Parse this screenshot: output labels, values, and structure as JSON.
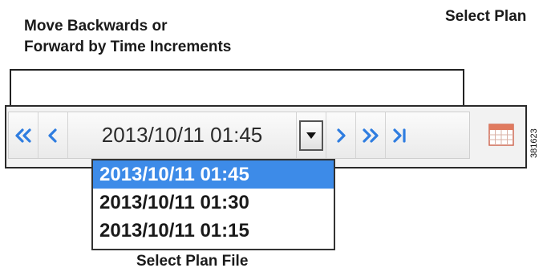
{
  "callouts": {
    "move_line1": "Move Backwards or",
    "move_line2": "Forward by Time Increments",
    "select_plan": "Select Plan",
    "select_plan_file": "Select Plan File"
  },
  "toolbar": {
    "current_time": "2013/10/11 01:45",
    "buttons": [
      "<<",
      "<",
      ">",
      ">>",
      ">|"
    ]
  },
  "dropdown": {
    "options": [
      "2013/10/11 01:45",
      "2013/10/11 01:30",
      "2013/10/11 01:15"
    ],
    "selected_index": 0
  },
  "figure_id": "381623",
  "icons": [
    "double-chevron-left-icon",
    "chevron-left-icon",
    "caret-down-icon",
    "chevron-right-icon",
    "double-chevron-right-icon",
    "skip-to-end-icon",
    "calendar-icon"
  ],
  "colors": {
    "accent": "#3d8be8",
    "selected_option": "#3d8be8"
  }
}
